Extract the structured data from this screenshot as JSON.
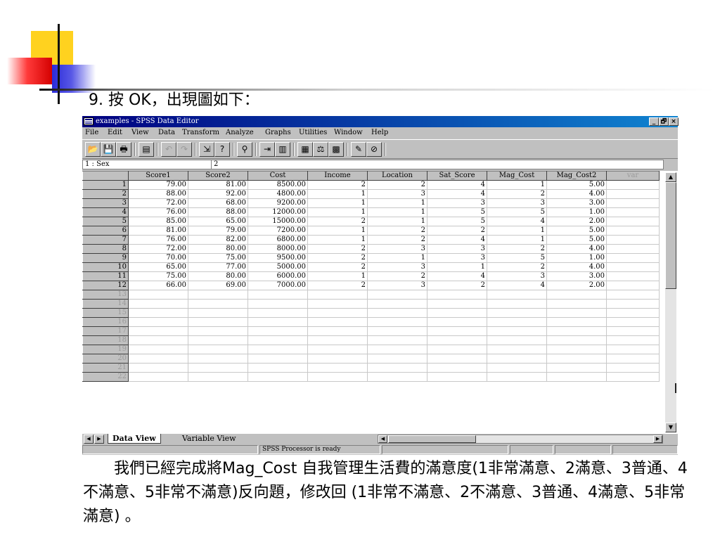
{
  "slide": {
    "title": "9. 按 OK，出現圖如下：",
    "body_text": "　　我們已經完成將Mag_Cost 自我管理生活費的滿意度(1非常滿意、2滿意、3普通、4不滿意、5非常不滿意)反向題，修改回 (1非常不滿意、2不滿意、3普通、4滿意、5非常滿意) 。"
  },
  "window": {
    "title": "examples - SPSS Data Editor",
    "controls": [
      "_",
      "🗗",
      "×"
    ]
  },
  "menu": [
    "File",
    "Edit",
    "View",
    "Data",
    "Transform",
    "Analyze",
    "Graphs",
    "Utilities",
    "Window",
    "Help"
  ],
  "toolbar_icons": [
    "open-icon",
    "save-icon",
    "print-icon",
    "dialog-recall-icon",
    "undo-icon",
    "redo-icon",
    "goto-case-icon",
    "variables-icon",
    "find-icon",
    "insert-case-icon",
    "insert-variable-icon",
    "split-file-icon",
    "weight-cases-icon",
    "select-cases-icon",
    "value-labels-icon",
    "use-sets-icon"
  ],
  "cell_editor": {
    "ref": "1 : Sex",
    "value": "2"
  },
  "grid": {
    "columns": [
      "Score1",
      "Score2",
      "Cost",
      "Income",
      "Location",
      "Sat_Score",
      "Mag_Cost",
      "Mag_Cost2",
      "var"
    ],
    "rows": [
      [
        "79.00",
        "81.00",
        "8500.00",
        "2",
        "2",
        "4",
        "1",
        "5.00"
      ],
      [
        "88.00",
        "92.00",
        "4800.00",
        "1",
        "3",
        "4",
        "2",
        "4.00"
      ],
      [
        "72.00",
        "68.00",
        "9200.00",
        "1",
        "1",
        "3",
        "3",
        "3.00"
      ],
      [
        "76.00",
        "88.00",
        "12000.00",
        "1",
        "1",
        "5",
        "5",
        "1.00"
      ],
      [
        "85.00",
        "65.00",
        "15000.00",
        "2",
        "1",
        "5",
        "4",
        "2.00"
      ],
      [
        "81.00",
        "79.00",
        "7200.00",
        "1",
        "2",
        "2",
        "1",
        "5.00"
      ],
      [
        "76.00",
        "82.00",
        "6800.00",
        "1",
        "2",
        "4",
        "1",
        "5.00"
      ],
      [
        "72.00",
        "80.00",
        "8000.00",
        "2",
        "3",
        "3",
        "2",
        "4.00"
      ],
      [
        "70.00",
        "75.00",
        "9500.00",
        "2",
        "1",
        "3",
        "5",
        "1.00"
      ],
      [
        "65.00",
        "77.00",
        "5000.00",
        "2",
        "3",
        "1",
        "2",
        "4.00"
      ],
      [
        "75.00",
        "80.00",
        "6000.00",
        "1",
        "2",
        "4",
        "3",
        "3.00"
      ],
      [
        "66.00",
        "69.00",
        "7000.00",
        "2",
        "3",
        "2",
        "4",
        "2.00"
      ]
    ],
    "empty_row_numbers": [
      "13",
      "14",
      "15",
      "16",
      "17",
      "18",
      "19",
      "20",
      "21",
      "22"
    ]
  },
  "tabs": {
    "data_view": "Data View",
    "variable_view": "Variable View"
  },
  "status": {
    "processor": "SPSS Processor  is ready"
  }
}
